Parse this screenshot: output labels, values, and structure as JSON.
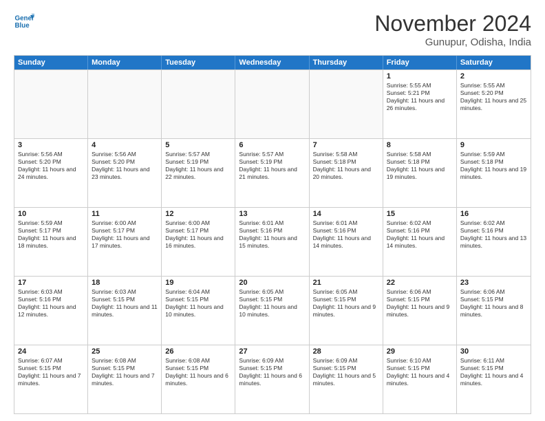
{
  "logo": {
    "line1": "General",
    "line2": "Blue"
  },
  "title": "November 2024",
  "location": "Gunupur, Odisha, India",
  "weekdays": [
    "Sunday",
    "Monday",
    "Tuesday",
    "Wednesday",
    "Thursday",
    "Friday",
    "Saturday"
  ],
  "rows": [
    [
      {
        "day": "",
        "info": ""
      },
      {
        "day": "",
        "info": ""
      },
      {
        "day": "",
        "info": ""
      },
      {
        "day": "",
        "info": ""
      },
      {
        "day": "",
        "info": ""
      },
      {
        "day": "1",
        "info": "Sunrise: 5:55 AM\nSunset: 5:21 PM\nDaylight: 11 hours and 26 minutes."
      },
      {
        "day": "2",
        "info": "Sunrise: 5:55 AM\nSunset: 5:20 PM\nDaylight: 11 hours and 25 minutes."
      }
    ],
    [
      {
        "day": "3",
        "info": "Sunrise: 5:56 AM\nSunset: 5:20 PM\nDaylight: 11 hours and 24 minutes."
      },
      {
        "day": "4",
        "info": "Sunrise: 5:56 AM\nSunset: 5:20 PM\nDaylight: 11 hours and 23 minutes."
      },
      {
        "day": "5",
        "info": "Sunrise: 5:57 AM\nSunset: 5:19 PM\nDaylight: 11 hours and 22 minutes."
      },
      {
        "day": "6",
        "info": "Sunrise: 5:57 AM\nSunset: 5:19 PM\nDaylight: 11 hours and 21 minutes."
      },
      {
        "day": "7",
        "info": "Sunrise: 5:58 AM\nSunset: 5:18 PM\nDaylight: 11 hours and 20 minutes."
      },
      {
        "day": "8",
        "info": "Sunrise: 5:58 AM\nSunset: 5:18 PM\nDaylight: 11 hours and 19 minutes."
      },
      {
        "day": "9",
        "info": "Sunrise: 5:59 AM\nSunset: 5:18 PM\nDaylight: 11 hours and 19 minutes."
      }
    ],
    [
      {
        "day": "10",
        "info": "Sunrise: 5:59 AM\nSunset: 5:17 PM\nDaylight: 11 hours and 18 minutes."
      },
      {
        "day": "11",
        "info": "Sunrise: 6:00 AM\nSunset: 5:17 PM\nDaylight: 11 hours and 17 minutes."
      },
      {
        "day": "12",
        "info": "Sunrise: 6:00 AM\nSunset: 5:17 PM\nDaylight: 11 hours and 16 minutes."
      },
      {
        "day": "13",
        "info": "Sunrise: 6:01 AM\nSunset: 5:16 PM\nDaylight: 11 hours and 15 minutes."
      },
      {
        "day": "14",
        "info": "Sunrise: 6:01 AM\nSunset: 5:16 PM\nDaylight: 11 hours and 14 minutes."
      },
      {
        "day": "15",
        "info": "Sunrise: 6:02 AM\nSunset: 5:16 PM\nDaylight: 11 hours and 14 minutes."
      },
      {
        "day": "16",
        "info": "Sunrise: 6:02 AM\nSunset: 5:16 PM\nDaylight: 11 hours and 13 minutes."
      }
    ],
    [
      {
        "day": "17",
        "info": "Sunrise: 6:03 AM\nSunset: 5:16 PM\nDaylight: 11 hours and 12 minutes."
      },
      {
        "day": "18",
        "info": "Sunrise: 6:03 AM\nSunset: 5:15 PM\nDaylight: 11 hours and 11 minutes."
      },
      {
        "day": "19",
        "info": "Sunrise: 6:04 AM\nSunset: 5:15 PM\nDaylight: 11 hours and 10 minutes."
      },
      {
        "day": "20",
        "info": "Sunrise: 6:05 AM\nSunset: 5:15 PM\nDaylight: 11 hours and 10 minutes."
      },
      {
        "day": "21",
        "info": "Sunrise: 6:05 AM\nSunset: 5:15 PM\nDaylight: 11 hours and 9 minutes."
      },
      {
        "day": "22",
        "info": "Sunrise: 6:06 AM\nSunset: 5:15 PM\nDaylight: 11 hours and 9 minutes."
      },
      {
        "day": "23",
        "info": "Sunrise: 6:06 AM\nSunset: 5:15 PM\nDaylight: 11 hours and 8 minutes."
      }
    ],
    [
      {
        "day": "24",
        "info": "Sunrise: 6:07 AM\nSunset: 5:15 PM\nDaylight: 11 hours and 7 minutes."
      },
      {
        "day": "25",
        "info": "Sunrise: 6:08 AM\nSunset: 5:15 PM\nDaylight: 11 hours and 7 minutes."
      },
      {
        "day": "26",
        "info": "Sunrise: 6:08 AM\nSunset: 5:15 PM\nDaylight: 11 hours and 6 minutes."
      },
      {
        "day": "27",
        "info": "Sunrise: 6:09 AM\nSunset: 5:15 PM\nDaylight: 11 hours and 6 minutes."
      },
      {
        "day": "28",
        "info": "Sunrise: 6:09 AM\nSunset: 5:15 PM\nDaylight: 11 hours and 5 minutes."
      },
      {
        "day": "29",
        "info": "Sunrise: 6:10 AM\nSunset: 5:15 PM\nDaylight: 11 hours and 4 minutes."
      },
      {
        "day": "30",
        "info": "Sunrise: 6:11 AM\nSunset: 5:15 PM\nDaylight: 11 hours and 4 minutes."
      }
    ]
  ]
}
